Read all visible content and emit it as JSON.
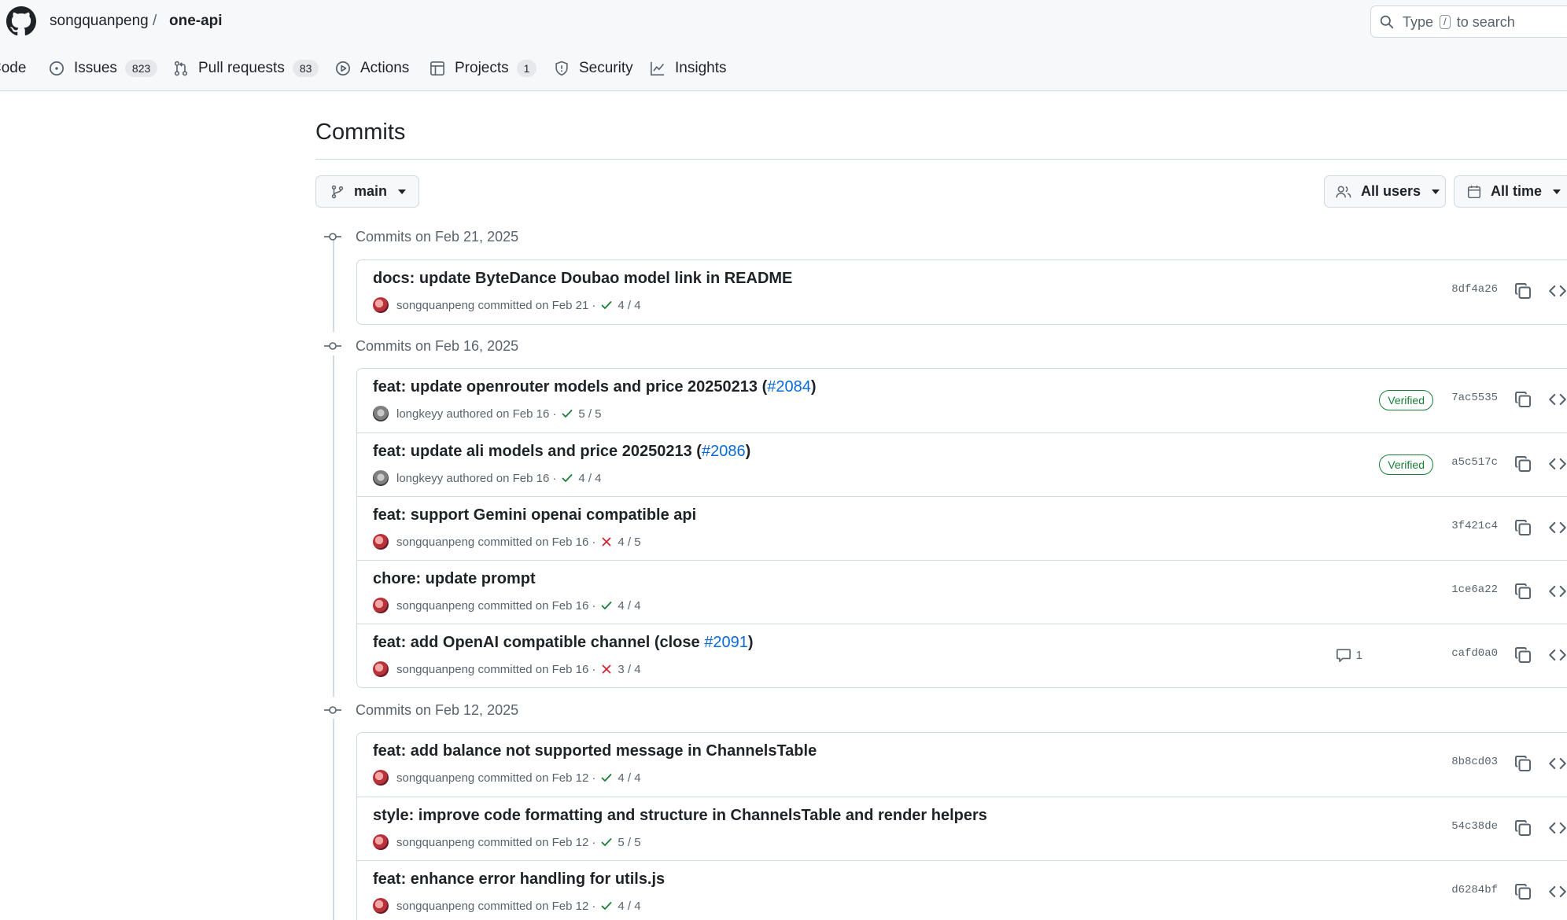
{
  "header": {
    "owner": "songquanpeng",
    "separator": "/",
    "repo": "one-api",
    "search_prefix": "Type",
    "search_key": "/",
    "search_suffix": "to search"
  },
  "nav": {
    "code": "Code",
    "issues": "Issues",
    "issues_count": "823",
    "pulls": "Pull requests",
    "pulls_count": "83",
    "actions": "Actions",
    "projects": "Projects",
    "projects_count": "1",
    "security": "Security",
    "insights": "Insights"
  },
  "page": {
    "title": "Commits",
    "branch": "main",
    "users_filter": "All users",
    "time_filter": "All time"
  },
  "groups": [
    {
      "heading": "Commits on Feb 21, 2025",
      "commits": [
        {
          "message": "docs: update ByteDance Doubao model link in README",
          "author": "songquanpeng",
          "action": "committed",
          "date": "on Feb 21",
          "status": "pass",
          "checks": "4 / 4",
          "sha": "8df4a26"
        }
      ]
    },
    {
      "heading": "Commits on Feb 16, 2025",
      "commits": [
        {
          "message": "feat: update openrouter models and price 20250213 (",
          "link": "#2084",
          "suffix": ")",
          "author": "longkeyy",
          "action": "authored",
          "date": "on Feb 16",
          "status": "pass",
          "checks": "5 / 5",
          "verified": "Verified",
          "sha": "7ac5535"
        },
        {
          "message": "feat: update ali models and price 20250213 (",
          "link": "#2086",
          "suffix": ")",
          "author": "longkeyy",
          "action": "authored",
          "date": "on Feb 16",
          "status": "pass",
          "checks": "4 / 4",
          "verified": "Verified",
          "sha": "a5c517c"
        },
        {
          "message": "feat: support Gemini openai compatible api",
          "author": "songquanpeng",
          "action": "committed",
          "date": "on Feb 16",
          "status": "fail",
          "checks": "4 / 5",
          "sha": "3f421c4"
        },
        {
          "message": "chore: update prompt",
          "author": "songquanpeng",
          "action": "committed",
          "date": "on Feb 16",
          "status": "pass",
          "checks": "4 / 4",
          "sha": "1ce6a22"
        },
        {
          "message": "feat: add OpenAI compatible channel (close ",
          "link": "#2091",
          "suffix": ")",
          "author": "songquanpeng",
          "action": "committed",
          "date": "on Feb 16",
          "status": "fail",
          "checks": "3 / 4",
          "comments": "1",
          "sha": "cafd0a0"
        }
      ]
    },
    {
      "heading": "Commits on Feb 12, 2025",
      "commits": [
        {
          "message": "feat: add balance not supported message in ChannelsTable",
          "author": "songquanpeng",
          "action": "committed",
          "date": "on Feb 12",
          "status": "pass",
          "checks": "4 / 4",
          "sha": "8b8cd03"
        },
        {
          "message": "style: improve code formatting and structure in ChannelsTable and render helpers",
          "author": "songquanpeng",
          "action": "committed",
          "date": "on Feb 12",
          "status": "pass",
          "checks": "5 / 5",
          "sha": "54c38de"
        },
        {
          "message": "feat: enhance error handling for utils.js",
          "author": "songquanpeng",
          "action": "committed",
          "date": "on Feb 12",
          "status": "pass",
          "checks": "4 / 4",
          "sha": "d6284bf"
        }
      ]
    }
  ],
  "colors": {
    "link": "#0969da",
    "pass": "#1a7f37",
    "fail": "#d1242f",
    "muted": "#59636e"
  }
}
